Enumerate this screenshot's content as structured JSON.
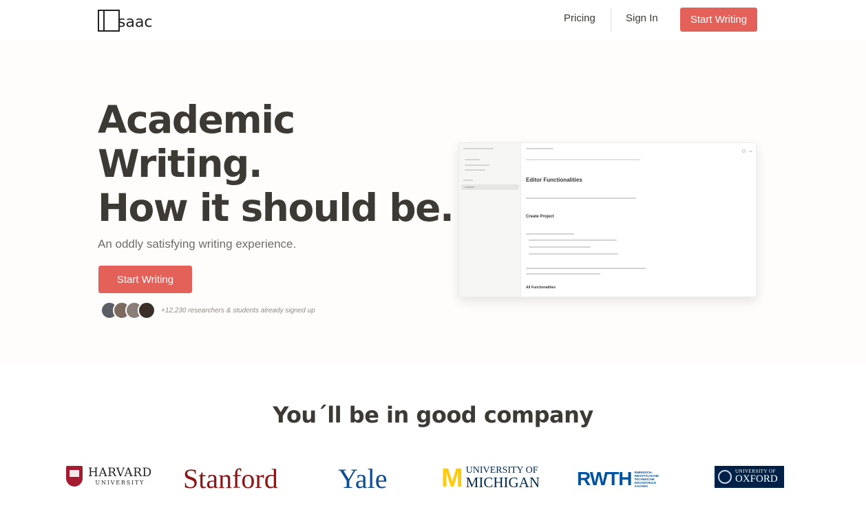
{
  "nav": {
    "logo_text": "saac",
    "pricing": "Pricing",
    "sign_in": "Sign In",
    "cta": "Start Writing"
  },
  "hero": {
    "title_lines": [
      "Academic",
      "Writing.",
      "How it should be."
    ],
    "subtitle": "An oddly satisfying writing experience.",
    "cta": "Start Writing",
    "social_proof": "+12,230 researchers & students already signed up",
    "avatar_colors": [
      "#5a5f66",
      "#7a6a60",
      "#8a7f78",
      "#3b2f2a"
    ]
  },
  "editor_preview": {
    "heading": "Editor Functionalities",
    "section": "Create Project",
    "footer_item": "All Functionalities"
  },
  "company": {
    "title": "You´ll be in good company",
    "logos": {
      "harvard_main": "HARVARD",
      "harvard_sub": "UNIVERSITY",
      "stanford": "Stanford",
      "yale": "Yale",
      "michigan_block": "M",
      "michigan_top": "UNIVERSITY OF",
      "michigan_bottom": "MICHIGAN",
      "rwth": "RWTH",
      "rwth_small": [
        "RHEINISCH-",
        "WESTFÄLISCHE",
        "TECHNISCHE",
        "HOCHSCHULE",
        "AACHEN"
      ],
      "oxford_top": "UNIVERSITY OF",
      "oxford_bottom": "OXFORD"
    }
  },
  "colors": {
    "accent": "#e36159",
    "text": "#3d3a36"
  }
}
